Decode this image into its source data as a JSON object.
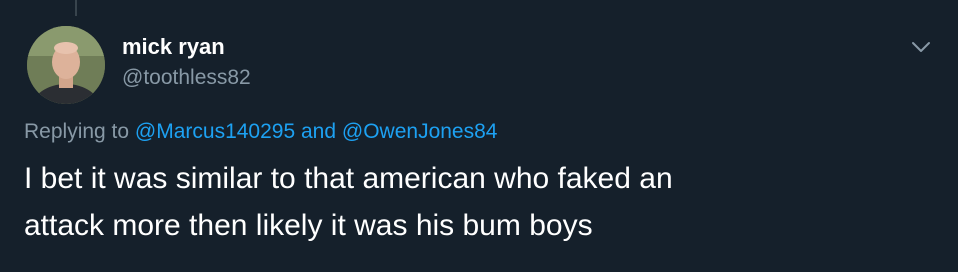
{
  "tweet": {
    "display_name": "mick ryan",
    "handle": "@toothless82",
    "replying_prefix": "Replying to",
    "reply_to_1": "@Marcus140295",
    "reply_joiner": "and",
    "reply_to_2": "@OwenJones84",
    "text_line_1": "I bet it was similar to that american who faked an",
    "text_line_2": "attack more then likely it was his bum boys"
  },
  "icons": {
    "menu": "chevron-down-icon"
  },
  "colors": {
    "background": "#15202b",
    "primary_text": "#ffffff",
    "secondary_text": "#8899a6",
    "link": "#1da1f2"
  }
}
